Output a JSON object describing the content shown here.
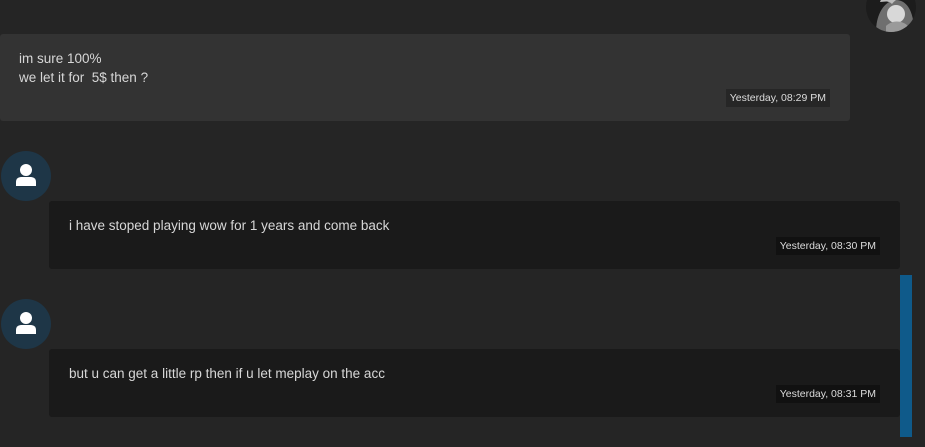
{
  "messages": [
    {
      "lines": [
        "im sure 100%",
        "we let it for  5$ then ?"
      ],
      "timestamp": "Yesterday, 08:29 PM"
    },
    {
      "lines": [
        "i have stoped playing wow for 1 years and come back"
      ],
      "timestamp": "Yesterday, 08:30 PM"
    },
    {
      "lines": [
        "but u can get a little rp then if u let meplay on the acc"
      ],
      "timestamp": "Yesterday, 08:31 PM"
    }
  ],
  "colors": {
    "background": "#252525",
    "outgoing_bubble": "#333333",
    "incoming_bubble": "#1a1a1a",
    "avatar_bg": "#1e3647",
    "scroll_thumb": "#0f5a8a"
  },
  "icons": {
    "user_avatar": "user-icon",
    "sender_avatar": "profile-photo"
  }
}
